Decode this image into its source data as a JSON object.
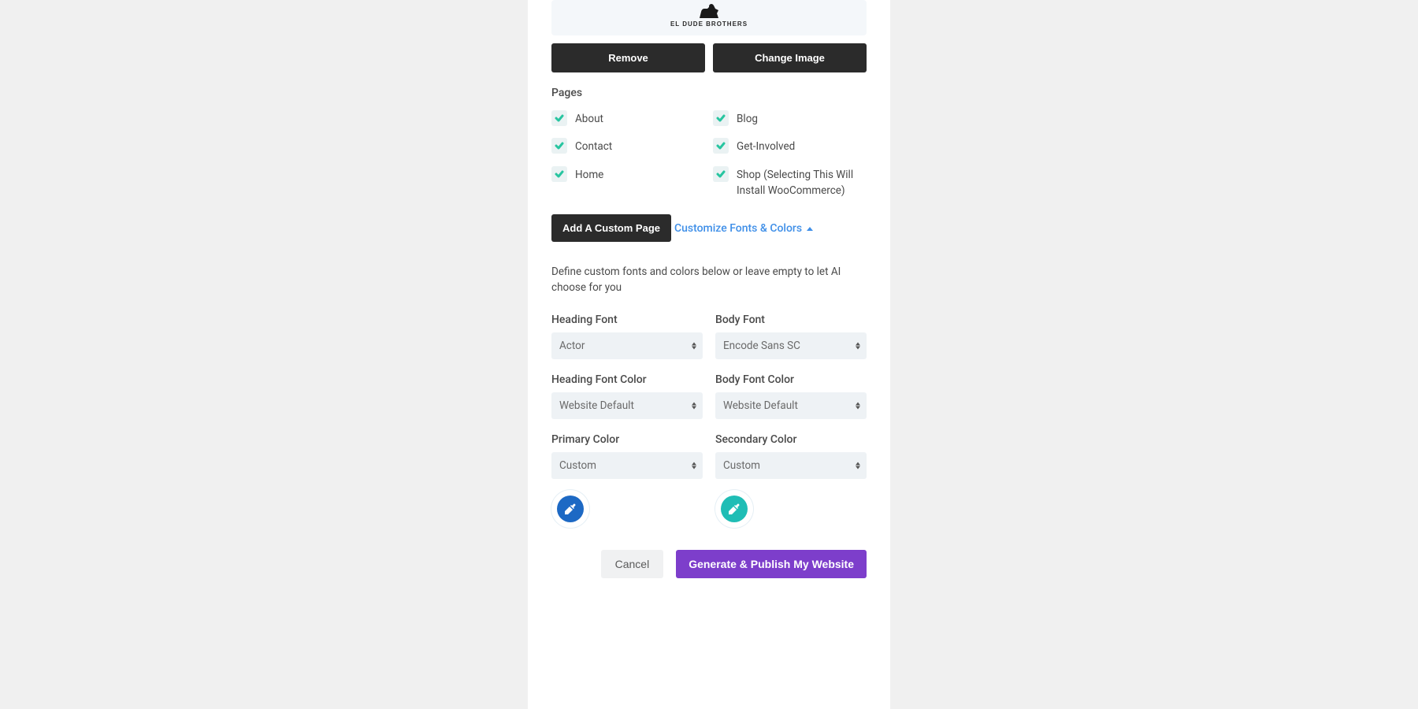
{
  "logo": {
    "caption": "EL DUDE BROTHERS"
  },
  "buttons": {
    "remove": "Remove",
    "change_image": "Change Image",
    "add_custom_page": "Add A Custom Page",
    "cancel": "Cancel",
    "generate": "Generate & Publish My Website"
  },
  "pages": {
    "label": "Pages",
    "items": [
      {
        "label": "About"
      },
      {
        "label": "Blog"
      },
      {
        "label": "Contact"
      },
      {
        "label": "Get-Involved"
      },
      {
        "label": "Home"
      },
      {
        "label": "Shop (Selecting This Will Install WooCommerce)"
      }
    ]
  },
  "customize": {
    "link": "Customize Fonts & Colors",
    "description": "Define custom fonts and colors below or leave empty to let AI choose for you"
  },
  "fields": {
    "heading_font": {
      "label": "Heading Font",
      "value": "Actor"
    },
    "body_font": {
      "label": "Body Font",
      "value": "Encode Sans SC"
    },
    "heading_font_color": {
      "label": "Heading Font Color",
      "value": "Website Default"
    },
    "body_font_color": {
      "label": "Body Font Color",
      "value": "Website Default"
    },
    "primary_color": {
      "label": "Primary Color",
      "value": "Custom",
      "swatch": "#1d69c4"
    },
    "secondary_color": {
      "label": "Secondary Color",
      "value": "Custom",
      "swatch": "#1fbdb5"
    }
  }
}
